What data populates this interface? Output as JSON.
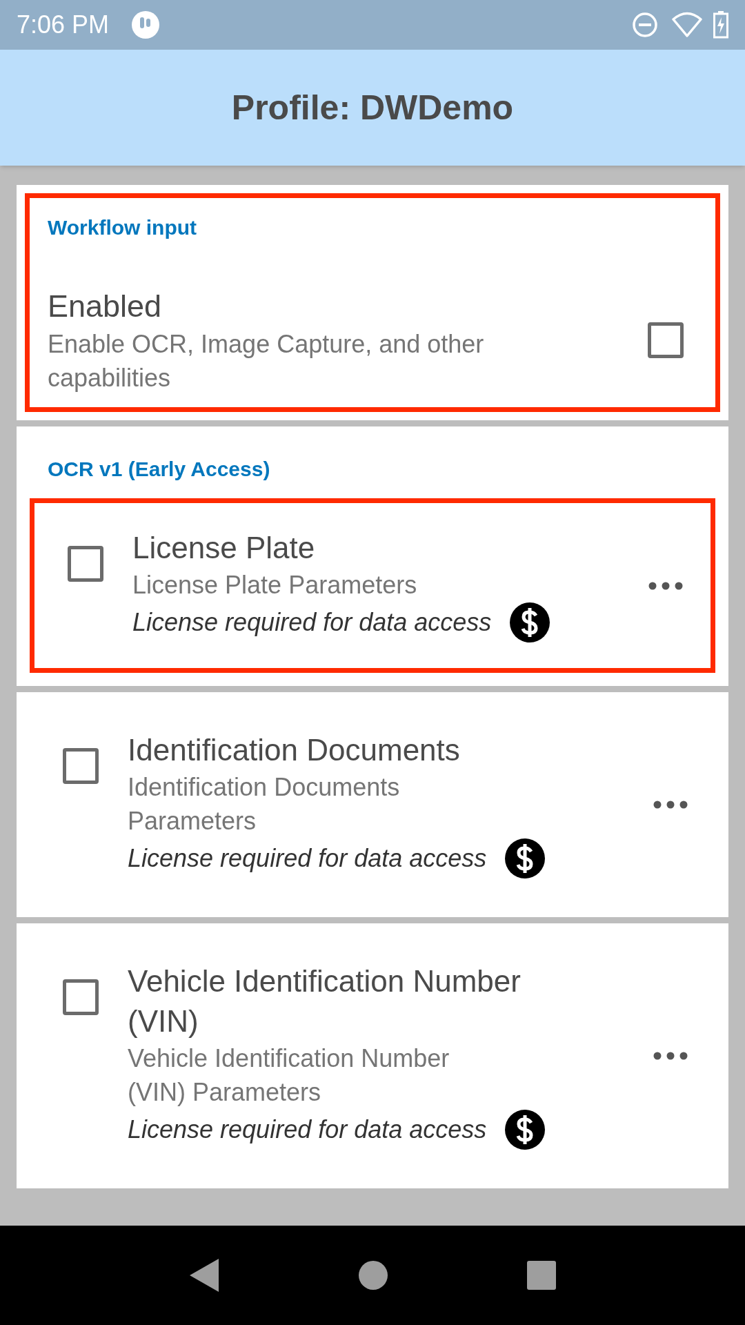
{
  "status_bar": {
    "time": "7:06 PM"
  },
  "app_bar": {
    "title": "Profile: DWDemo"
  },
  "sections": [
    {
      "header": "Workflow input",
      "highlighted": true,
      "items": [
        {
          "kind": "toggle",
          "title": "Enabled",
          "subtitle": "Enable OCR, Image Capture, and other capabilities",
          "checked": false
        }
      ]
    },
    {
      "header": "OCR v1 (Early Access)",
      "highlighted": false,
      "items": [
        {
          "kind": "feature",
          "title": "License Plate",
          "subtitle": "License Plate Parameters",
          "note": "License required for data access",
          "checked": false,
          "highlighted": true
        },
        {
          "kind": "feature",
          "title": "Identification Documents",
          "subtitle": "Identification Documents Parameters",
          "note": "License required for data access",
          "checked": false,
          "highlighted": false
        },
        {
          "kind": "feature",
          "title": "Vehicle Identification Number (VIN)",
          "subtitle": "Vehicle Identification Number (VIN) Parameters",
          "note": "License required for data access",
          "checked": false,
          "highlighted": false
        }
      ]
    }
  ]
}
